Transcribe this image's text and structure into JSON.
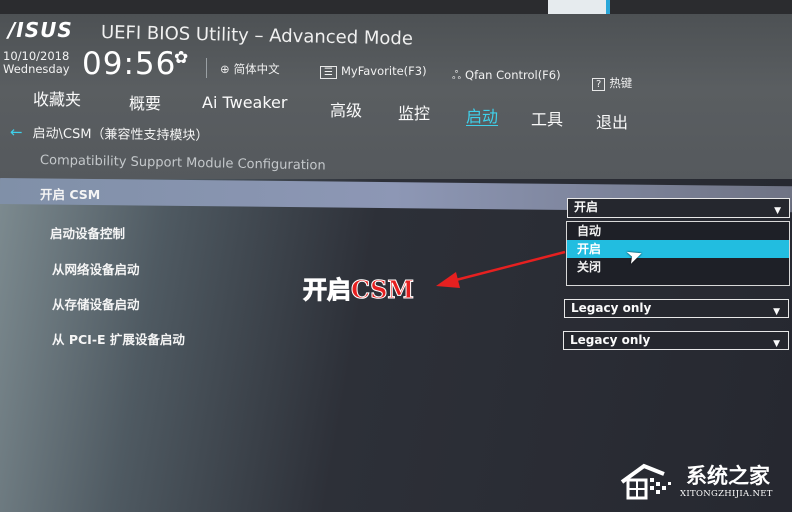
{
  "header": {
    "brand": "/ISUS",
    "title": "UEFI BIOS Utility – Advanced Mode",
    "date": "10/10/2018",
    "weekday": "Wednesday",
    "time": "09:56",
    "toolbar": [
      {
        "icon": "globe-icon",
        "label": "简体中文"
      },
      {
        "icon": "favorite-icon",
        "label": "MyFavorite(F3)"
      },
      {
        "icon": "fan-icon",
        "label": "Qfan Control(F6)"
      },
      {
        "icon": "help-icon",
        "label": "热键"
      }
    ]
  },
  "tabs": [
    {
      "label": "收藏夹",
      "active": false
    },
    {
      "label": "概要",
      "active": false
    },
    {
      "label": "Ai Tweaker",
      "active": false
    },
    {
      "label": "高级",
      "active": false
    },
    {
      "label": "监控",
      "active": false
    },
    {
      "label": "启动",
      "active": true
    },
    {
      "label": "工具",
      "active": false
    },
    {
      "label": "退出",
      "active": false
    }
  ],
  "breadcrumb": "启动\\CSM（兼容性支持模块）",
  "subtitle": "Compatibility Support Module Configuration",
  "settings": [
    {
      "label": "开启 CSM",
      "value": "开启",
      "highlighted": true
    },
    {
      "label": "启动设备控制",
      "value": ""
    },
    {
      "label": "从网络设备启动",
      "value": ""
    },
    {
      "label": "从存储设备启动",
      "value": "Legacy only"
    },
    {
      "label": "从 PCI-E 扩展设备启动",
      "value": "Legacy only"
    }
  ],
  "dropdown": {
    "options": [
      "自动",
      "开启",
      "关闭"
    ],
    "selected": "开启"
  },
  "annotation": "开启CSM",
  "accent_color": "#22bde0",
  "annotation_color": "#e62020",
  "watermark": {
    "name": "系统之家",
    "url": "XITONGZHIJIA.NET"
  }
}
